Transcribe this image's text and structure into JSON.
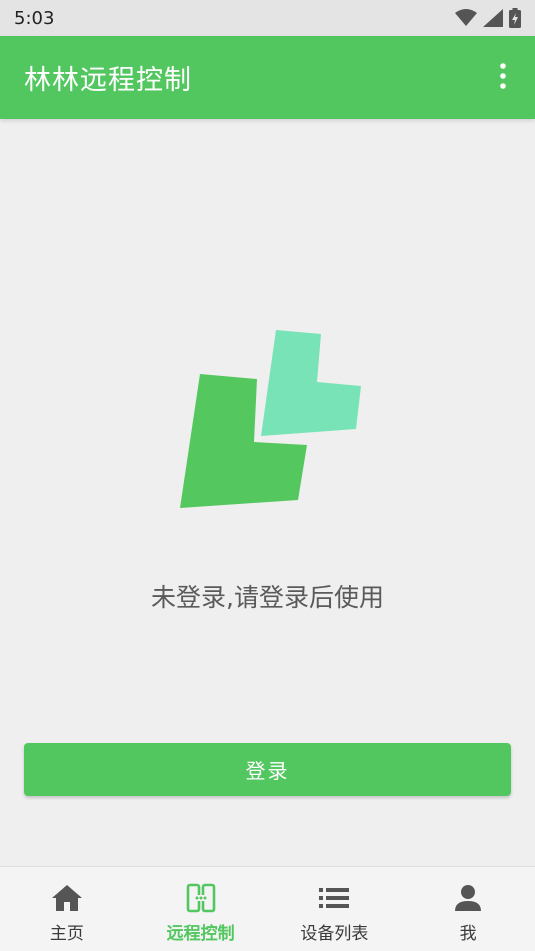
{
  "status_bar": {
    "time": "5:03",
    "icons": [
      "wifi-icon",
      "cell-signal-icon",
      "battery-charging-icon"
    ]
  },
  "app_bar": {
    "title": "林林远程控制",
    "overflow_icon": "more-vertical-icon"
  },
  "content": {
    "logo_colors": [
      "#55c75f",
      "#78e3b6"
    ],
    "message": "未登录,请登录后使用",
    "login_button_label": "登录"
  },
  "bottom_nav": {
    "items": [
      {
        "label": "主页",
        "icon": "home-icon",
        "active": false
      },
      {
        "label": "远程控制",
        "icon": "remote-control-icon",
        "active": true
      },
      {
        "label": "设备列表",
        "icon": "list-icon",
        "active": false
      },
      {
        "label": "我",
        "icon": "person-icon",
        "active": false
      }
    ]
  },
  "colors": {
    "accent": "#52c760",
    "background": "#efefef",
    "status_bar": "#e4e4e4"
  }
}
